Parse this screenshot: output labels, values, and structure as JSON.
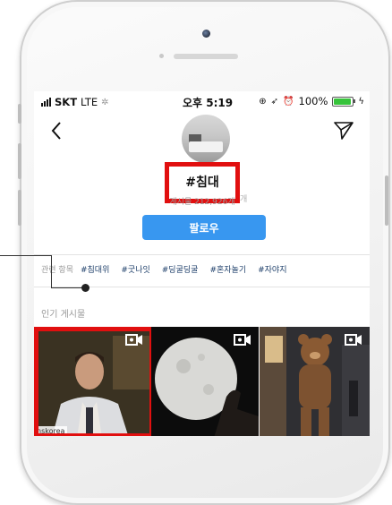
{
  "status_bar": {
    "carrier": "SKT",
    "network": "LTE",
    "time": "오후 5:19",
    "battery": "100%",
    "battery_level": 1.0
  },
  "header": {
    "hashtag": "#침대",
    "post_count": "게시물 212,926개",
    "post_count_visible_tail": "게시물 212,926개",
    "back_icon": "chevron-left-icon",
    "share_icon": "paper-plane-icon"
  },
  "follow_button": {
    "label": "팔로우"
  },
  "related": {
    "label": "관련 항목",
    "tags": [
      "#침대위",
      "#굿나잇",
      "#딩굴딩굴",
      "#혼자놀기",
      "#자야지"
    ]
  },
  "popular": {
    "label": "인기 게시물",
    "posts": [
      {
        "watermark": "nskorea",
        "icon": "video-camera-icon"
      },
      {
        "icon": "video-camera-icon"
      },
      {
        "icon": "video-camera-icon"
      }
    ]
  },
  "colors": {
    "highlight": "#e10f0f",
    "follow": "#3897f0",
    "tag_text": "#1e3f6a"
  }
}
